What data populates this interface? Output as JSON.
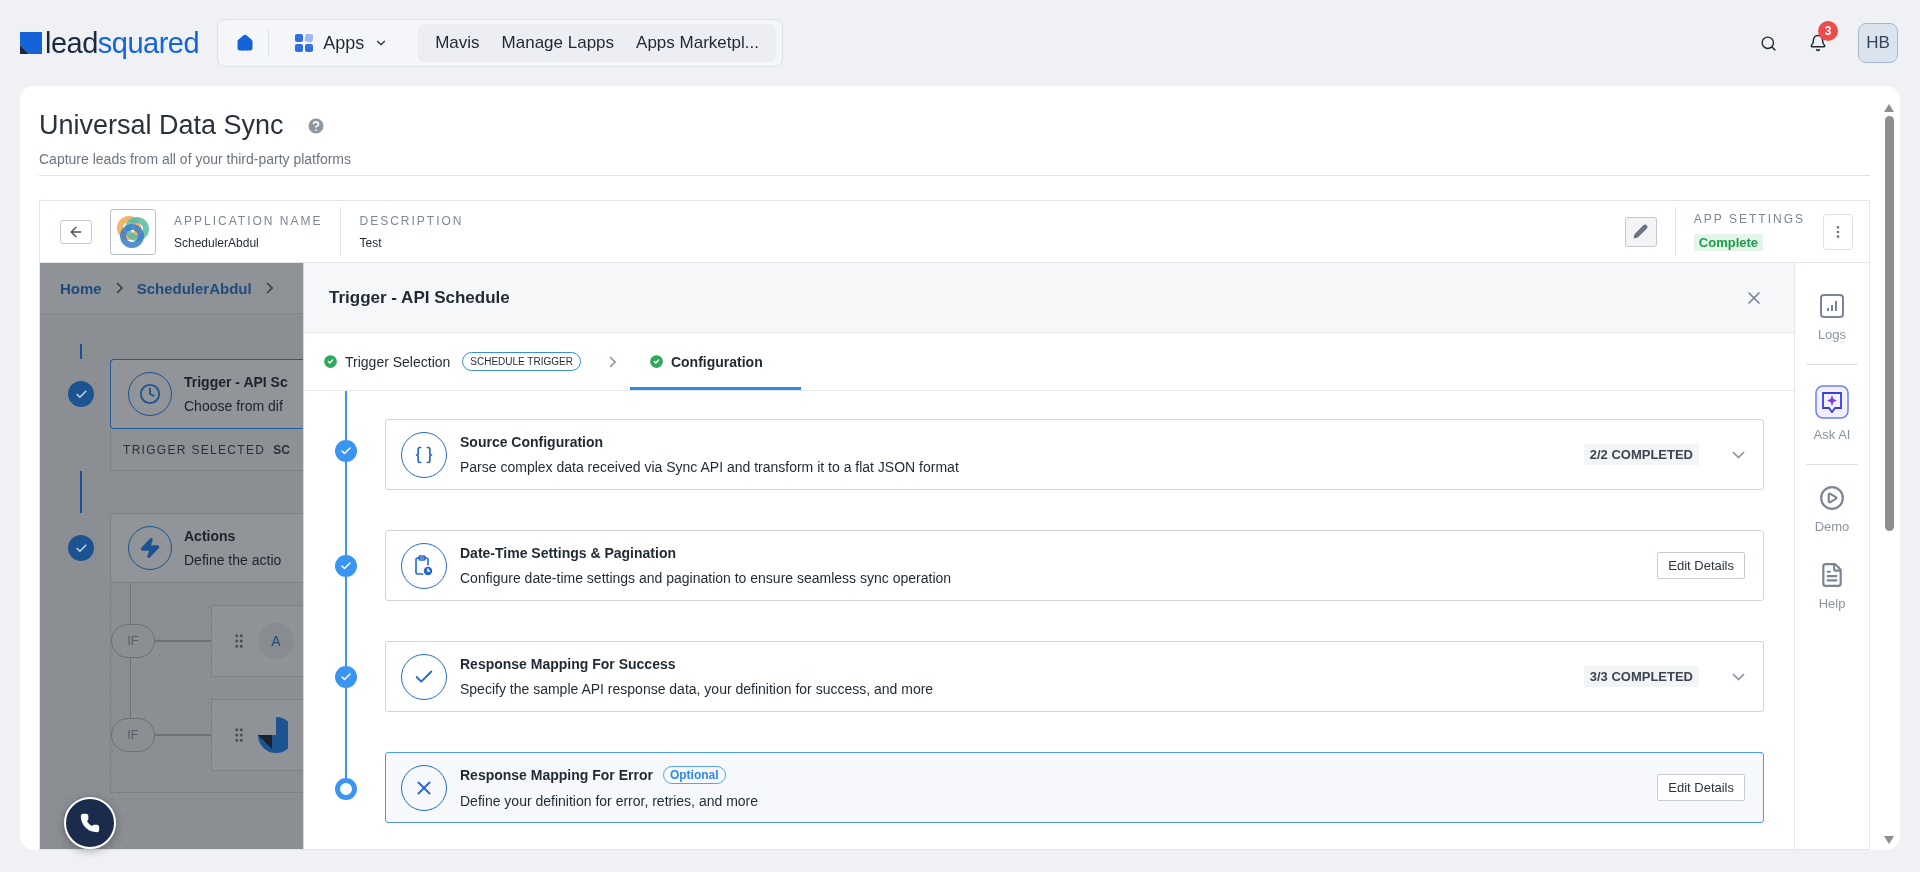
{
  "topbar": {
    "logo": {
      "dark_part": "lead",
      "accent_part": "squared"
    },
    "apps_label": "Apps",
    "links": [
      "Mavis",
      "Manage Lapps",
      "Apps Marketpl..."
    ],
    "notification_count": "3",
    "avatar": "HB"
  },
  "page": {
    "title": "Universal Data Sync",
    "subtitle": "Capture leads from all of your third-party platforms"
  },
  "app_header": {
    "name_label": "APPLICATION NAME",
    "name": "SchedulerAbdul",
    "description_label": "DESCRIPTION",
    "description": "Test",
    "settings_label": "APP SETTINGS",
    "settings_status": "Complete"
  },
  "canvas": {
    "breadcrumb": [
      "Home",
      "SchedulerAbdul"
    ],
    "steps": [
      {
        "title": "Trigger - API Sc",
        "description": "Choose from dif",
        "done": true
      },
      {
        "title": "Actions",
        "description": "Define the actio",
        "done": true
      }
    ],
    "trigger_selected_label": "TRIGGER SELECTED",
    "trigger_selected_value": "SC",
    "conditions": [
      {
        "label": "IF",
        "node": "A"
      },
      {
        "label": "IF"
      }
    ]
  },
  "modal": {
    "title": "Trigger - API Schedule",
    "tabs": [
      {
        "label": "Trigger Selection",
        "badge": "SCHEDULE TRIGGER",
        "done": true,
        "selected": false
      },
      {
        "label": "Configuration",
        "done": true,
        "selected": true
      }
    ],
    "steps": [
      {
        "kind": "progress",
        "title": "Source Configuration",
        "description": "Parse complex data received via Sync API and transform it to a flat JSON format",
        "status": "2/2 COMPLETED",
        "done": true,
        "selected": false
      },
      {
        "kind": "edit",
        "title": "Date-Time Settings & Pagination",
        "description": "Configure date-time settings and pagination to ensure seamless sync operation",
        "action": "Edit Details",
        "done": true,
        "selected": false
      },
      {
        "kind": "progress",
        "title": "Response Mapping For Success",
        "description": "Specify the sample API response data, your definition for success, and more",
        "status": "3/3 COMPLETED",
        "done": true,
        "selected": false
      },
      {
        "kind": "edit",
        "title": "Response Mapping For Error",
        "badge": "Optional",
        "description": "Define your definition for error, retries, and more",
        "action": "Edit Details",
        "done": false,
        "selected": true
      }
    ]
  },
  "rail": [
    {
      "label": "Logs"
    },
    {
      "label": "Ask AI"
    },
    {
      "label": "Demo"
    },
    {
      "label": "Help"
    }
  ]
}
